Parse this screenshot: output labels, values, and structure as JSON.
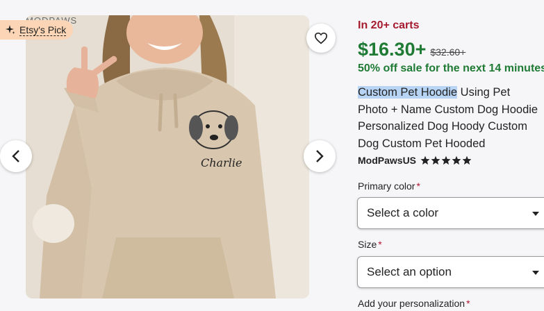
{
  "gallery": {
    "watermark": "MODPAWS",
    "badge": "Etsy's Pick",
    "shirt_text": "Charlie",
    "icons": {
      "badge": "sparkle-icon",
      "favorite": "heart-icon",
      "prev": "chevron-left-icon",
      "next": "chevron-right-icon"
    }
  },
  "product": {
    "carts_text": "In 20+ carts",
    "price": "$16.30+",
    "original_price": "$32.60+",
    "sale_text": "50% off sale for the next 14 minutes",
    "title_highlight": "Custom Pet Hoodie",
    "title_rest_1": " Using Pet",
    "title_line_2": "Photo + Name Custom Dog Hoodie",
    "title_line_3": "Personalized Dog Hoody Custom",
    "title_line_4": "Dog Custom Pet Hooded",
    "seller": "ModPawsUS",
    "rating": 5
  },
  "options": {
    "primary_color_label": "Primary color",
    "primary_color_value": "Select a color",
    "size_label": "Size",
    "size_value": "Select an option",
    "personalization_label": "Add your personalization",
    "required_mark": "*"
  },
  "colors": {
    "price": "#1f7a34",
    "carts": "#a61a2e",
    "highlight": "#b7d4f5",
    "badge_bg": "#fbd5b5"
  }
}
